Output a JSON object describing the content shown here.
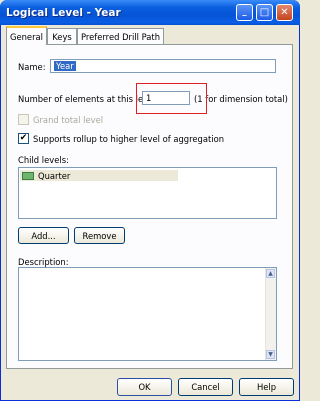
{
  "window": {
    "title": "Logical Level - Year",
    "minimize_glyph": "_",
    "maximize_glyph": "□",
    "close_glyph": "✕"
  },
  "tabs": [
    {
      "label": "General",
      "active": true
    },
    {
      "label": "Keys",
      "active": false
    },
    {
      "label": "Preferred Drill Path",
      "active": false
    }
  ],
  "general": {
    "name_label": "Name:",
    "name_value": "Year",
    "elements_label": "Number of elements at this level:",
    "elements_value": "1",
    "elements_note": "(1 for dimension total)",
    "grand_total_label": "Grand total level",
    "grand_total_checked": false,
    "rollup_label": "Supports rollup to higher level of aggregation",
    "rollup_checked": true,
    "child_levels_label": "Child levels:",
    "child_levels": [
      "Quarter"
    ],
    "add_button": "Add...",
    "remove_button": "Remove",
    "description_label": "Description:",
    "description_value": ""
  },
  "footer": {
    "ok": "OK",
    "cancel": "Cancel",
    "help": "Help"
  },
  "colors": {
    "titlebar": "#0a5fe0",
    "highlight_box": "#e02020",
    "selection": "#316ac5"
  }
}
